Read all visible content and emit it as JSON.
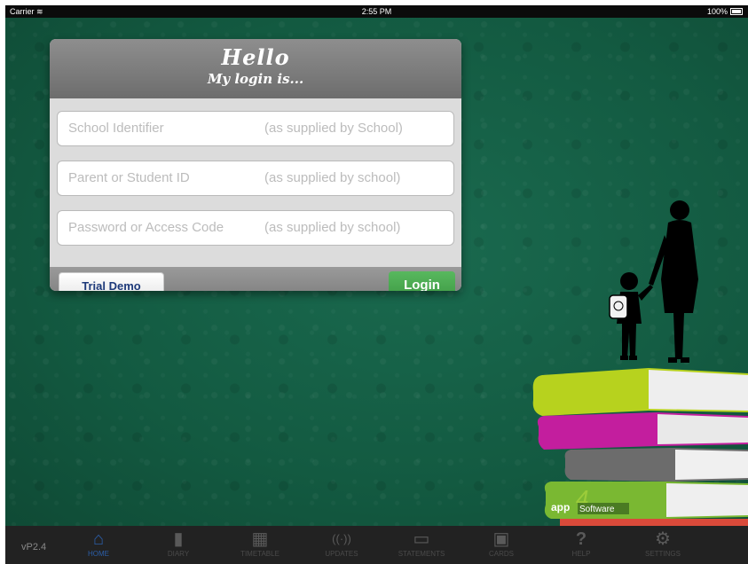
{
  "status_bar": {
    "carrier": "Carrier",
    "time": "2:55 PM",
    "battery": "100%"
  },
  "login_card": {
    "title": "Hello",
    "subtitle": "My login is...",
    "fields": [
      {
        "placeholder": "School Identifier",
        "hint": "(as supplied by School)"
      },
      {
        "placeholder": "Parent or Student ID",
        "hint": "(as supplied by school)"
      },
      {
        "placeholder": "Password or Access Code",
        "hint": "(as supplied by school)"
      }
    ],
    "trial_button": "Trial Demo",
    "login_button": "Login"
  },
  "logo": {
    "text1": "app",
    "text2": "Software",
    "numeral": "4"
  },
  "tab_bar": {
    "version": "vP2.4",
    "tabs": [
      {
        "label": "HOME",
        "icon": "home-icon",
        "glyph": "⌂"
      },
      {
        "label": "DIARY",
        "icon": "diary-icon",
        "glyph": "▮"
      },
      {
        "label": "TIMETABLE",
        "icon": "calendar-icon",
        "glyph": "▦"
      },
      {
        "label": "UPDATES",
        "icon": "broadcast-icon",
        "glyph": "((·))"
      },
      {
        "label": "STATEMENTS",
        "icon": "statements-icon",
        "glyph": "▭"
      },
      {
        "label": "CARDS",
        "icon": "card-icon",
        "glyph": "▣"
      },
      {
        "label": "HELP",
        "icon": "help-icon",
        "glyph": "?"
      },
      {
        "label": "SETTINGS",
        "icon": "gear-icon",
        "glyph": "⚙"
      }
    ]
  },
  "colors": {
    "background": "#135a41",
    "login_green": "#3e9a45",
    "tab_active": "#2b5ea8"
  }
}
